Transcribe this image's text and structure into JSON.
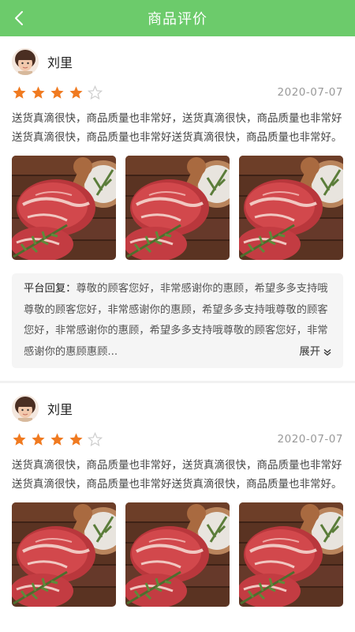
{
  "navbar": {
    "title": "商品评价",
    "back_icon": "chevron-left-icon",
    "color": "#6ccb6b"
  },
  "reviews": [
    {
      "user_name": "刘里",
      "rating": 4,
      "max_rating": 5,
      "date": "2020-07-07",
      "text": "送货真滴很快，商品质量也非常好，送货真滴很快，商品质量也非常好送货真滴很快，商品质量也非常好送货真滴很快，商品质量也非常好。",
      "reply_label": "平台回复：",
      "reply_text": "尊敬的顾客您好，非常感谢你的惠顾，希望多多支持哦尊敬的顾客您好，非常感谢你的惠顾，希望多多支持哦尊敬的顾客您好，非常感谢你的惠顾，希望多多支持哦尊敬的顾客您好，非常感谢你的惠顾惠顾...",
      "expand_label": "展开"
    },
    {
      "user_name": "刘里",
      "rating": 4,
      "max_rating": 5,
      "date": "2020-07-07",
      "text": "送货真滴很快，商品质量也非常好，送货真滴很快，商品质量也非常好送货真滴很快，商品质量也非常好送货真滴很快，商品质量也非常好。"
    }
  ],
  "colors": {
    "star_filled": "#f07a20",
    "star_empty": "#cccccc"
  }
}
